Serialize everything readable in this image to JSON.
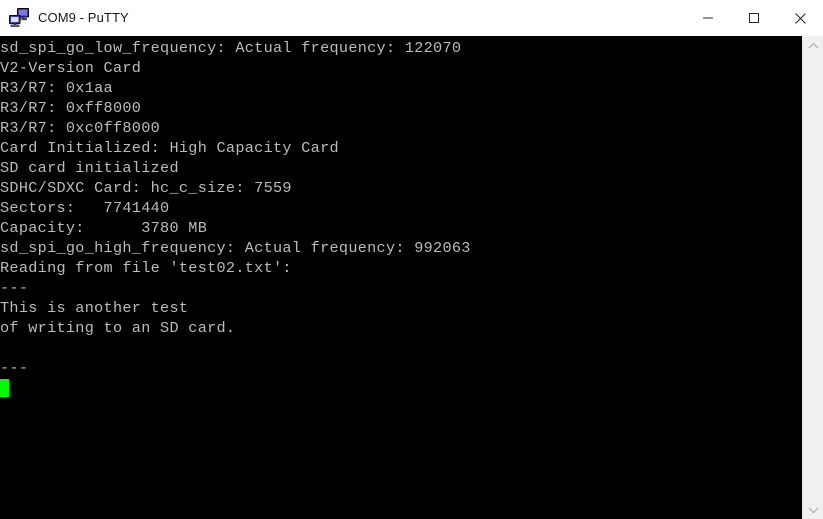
{
  "window": {
    "title": "COM9 - PuTTY",
    "icon": "putty-computer-icon",
    "background_color": "#000000",
    "titlebar_color": "#ffffff",
    "title_text_color": "#1a1a1a"
  },
  "controls": {
    "minimize_label": "Minimize",
    "maximize_label": "Maximize",
    "close_label": "Close"
  },
  "terminal": {
    "foreground_color": "#bbbbbb",
    "background_color": "#000000",
    "cursor_color": "#00ff00",
    "lines": [
      "sd_spi_go_low_frequency: Actual frequency: 122070",
      "V2-Version Card",
      "R3/R7: 0x1aa",
      "R3/R7: 0xff8000",
      "R3/R7: 0xc0ff8000",
      "Card Initialized: High Capacity Card",
      "SD card initialized",
      "SDHC/SDXC Card: hc_c_size: 7559",
      "Sectors:   7741440",
      "Capacity:      3780 MB",
      "sd_spi_go_high_frequency: Actual frequency: 992063",
      "Reading from file 'test02.txt':",
      "---",
      "This is another test",
      "of writing to an SD card.",
      "",
      "---"
    ]
  },
  "scrollbar": {
    "up_arrow": "chevron-up-icon",
    "down_arrow": "chevron-down-icon",
    "track_color": "#f0f0f0"
  }
}
